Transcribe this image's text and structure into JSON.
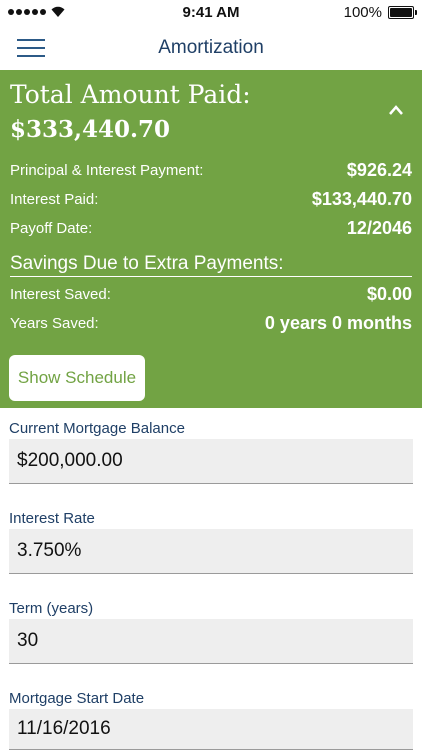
{
  "status_bar": {
    "time": "9:41 AM",
    "battery": "100%"
  },
  "header": {
    "title": "Amortization",
    "menu_icon": "hamburger-menu-icon"
  },
  "summary": {
    "total_label": "Total Amount Paid:",
    "total_value": "$333,440.70",
    "collapse_icon": "chevron-up-icon",
    "rows": [
      {
        "label": "Principal & Interest Payment:",
        "value": "$926.24"
      },
      {
        "label": "Interest Paid:",
        "value": "$133,440.70"
      },
      {
        "label": "Payoff Date:",
        "value": "12/2046"
      }
    ],
    "savings_title": "Savings Due to Extra Payments:",
    "savings_rows": [
      {
        "label": "Interest Saved:",
        "value": "$0.00"
      },
      {
        "label": "Years Saved:",
        "value": "0 years 0 months"
      }
    ],
    "schedule_button": "Show Schedule"
  },
  "form": {
    "fields": [
      {
        "label": "Current Mortgage Balance",
        "value": "$200,000.00"
      },
      {
        "label": "Interest Rate",
        "value": "3.750%"
      },
      {
        "label": "Term (years)",
        "value": "30"
      },
      {
        "label": "Mortgage Start Date",
        "value": "11/16/2016"
      }
    ]
  },
  "colors": {
    "accent_green": "#72a344",
    "navy": "#1f3f66"
  }
}
